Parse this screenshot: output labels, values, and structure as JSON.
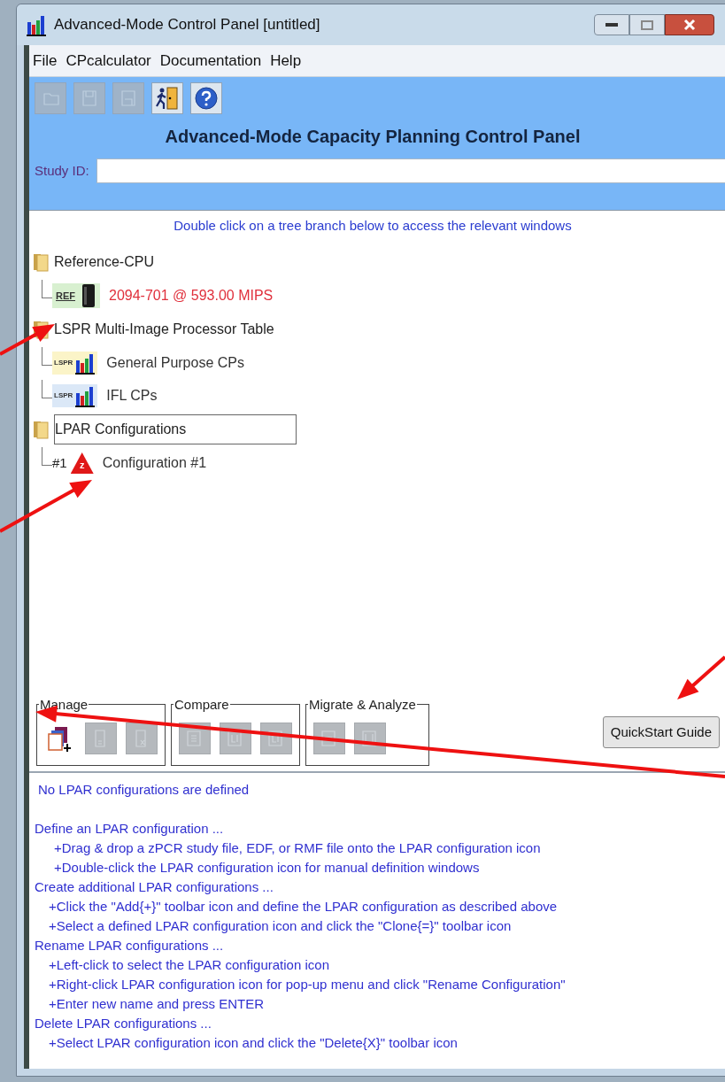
{
  "window": {
    "title": "Advanced-Mode Control Panel [untitled]"
  },
  "menu": [
    "File",
    "CPcalculator",
    "Documentation",
    "Help"
  ],
  "toolbar": [
    {
      "kind": "open",
      "disabled": true
    },
    {
      "kind": "save",
      "disabled": true
    },
    {
      "kind": "saveas",
      "disabled": true
    },
    {
      "kind": "exit",
      "disabled": false
    },
    {
      "kind": "help",
      "disabled": false
    }
  ],
  "heading": "Advanced-Mode Capacity Planning Control Panel",
  "study_id": {
    "label": "Study ID:"
  },
  "instruction": "Double click on a tree branch below to access the relevant windows",
  "tree": [
    {
      "label": "Reference-CPU",
      "selected": false,
      "children": [
        {
          "kind": "ref",
          "badge": "REF",
          "label": "2094-701 @ 593.00 MIPS",
          "color": "#e0303c",
          "selected": false
        }
      ]
    },
    {
      "label": "LSPR Multi-Image Processor Table",
      "selected": false,
      "children": [
        {
          "kind": "lspr",
          "badge": "LSPR",
          "label": "General Purpose CPs",
          "color": "#333333",
          "selected": false
        },
        {
          "kind": "lspr",
          "badge": "LSPR",
          "label": "IFL CPs",
          "color": "#333333",
          "selected": false
        }
      ]
    },
    {
      "label": "LPAR Configurations",
      "selected": true,
      "children": [
        {
          "kind": "config",
          "prefix": "#1",
          "badge": "z",
          "label": "Configuration #1",
          "color": "#333333",
          "selected": false
        }
      ]
    }
  ],
  "groups": [
    {
      "title": "Manage",
      "buttons": [
        {
          "kind": "add",
          "disabled": false
        },
        {
          "kind": "clone",
          "disabled": true
        },
        {
          "kind": "delete",
          "disabled": true
        }
      ]
    },
    {
      "title": "Compare",
      "buttons": [
        {
          "kind": "s",
          "disabled": true
        },
        {
          "kind": "c",
          "disabled": true
        },
        {
          "kind": "c",
          "disabled": true
        }
      ]
    },
    {
      "title": "Migrate & Analyze",
      "buttons": [
        {
          "kind": "e",
          "disabled": true
        },
        {
          "kind": "m",
          "disabled": true
        }
      ]
    }
  ],
  "quickstart_button": "QuickStart Guide",
  "messages": [
    {
      "kind": "status",
      "text": "No LPAR configurations are defined"
    },
    {
      "kind": "heading",
      "text": "Define an LPAR configuration ..."
    },
    {
      "kind": "deep",
      "text": "+Drag & drop a zPCR study file, EDF, or RMF file onto the LPAR configuration icon"
    },
    {
      "kind": "deep",
      "text": "+Double-click the LPAR configuration icon for manual definition windows"
    },
    {
      "kind": "heading",
      "text": "Create additional LPAR configurations ..."
    },
    {
      "kind": "step",
      "text": "+Click the \"Add{+}\" toolbar icon and define the LPAR configuration as described above"
    },
    {
      "kind": "step",
      "text": "+Select a defined LPAR configuration icon and click the \"Clone{=}\" toolbar icon"
    },
    {
      "kind": "heading",
      "text": "Rename LPAR configurations ..."
    },
    {
      "kind": "step",
      "text": "+Left-click to select the LPAR configuration icon"
    },
    {
      "kind": "step",
      "text": "+Right-click LPAR configuration icon for pop-up menu and click \"Rename Configuration\""
    },
    {
      "kind": "step",
      "text": "+Enter new name and press ENTER"
    },
    {
      "kind": "heading",
      "text": "Delete LPAR configurations ..."
    },
    {
      "kind": "step",
      "text": "+Select LPAR configuration icon and click the \"Delete{X}\" toolbar icon"
    }
  ]
}
